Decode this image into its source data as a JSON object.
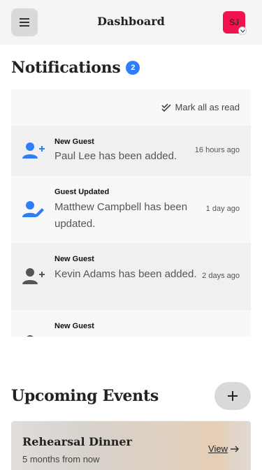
{
  "header": {
    "title": "Dashboard",
    "avatar_initials": "SJ",
    "avatar_color": "#f0134d",
    "menu_icon": "hamburger-icon"
  },
  "notifications": {
    "heading": "Notifications",
    "count": "2",
    "mark_all_label": "Mark all as read",
    "items": [
      {
        "type": "New Guest",
        "message": "Paul Lee has been added.",
        "time": "16 hours ago",
        "icon": "user-plus-icon",
        "icon_color": "#2d7ff9"
      },
      {
        "type": "Guest Updated",
        "message": "Matthew Campbell has been updated.",
        "time": "1 day ago",
        "icon": "user-edit-icon",
        "icon_color": "#2d7ff9"
      },
      {
        "type": "New Guest",
        "message": "Kevin Adams has been added.",
        "time": "2 days ago",
        "icon": "user-plus-icon",
        "icon_color": "#555555"
      },
      {
        "type": "New Guest",
        "message": "",
        "time": "",
        "icon": "user-plus-icon",
        "icon_color": "#555555"
      }
    ]
  },
  "events": {
    "heading": "Upcoming Events",
    "add_icon": "plus-icon",
    "items": [
      {
        "name": "Rehearsal Dinner",
        "when": "5 months from now",
        "view_label": "View"
      }
    ]
  },
  "colors": {
    "accent_blue": "#2d7ff9",
    "header_bg": "#f5f5f5",
    "panel_bg": "#f8f8f8"
  }
}
